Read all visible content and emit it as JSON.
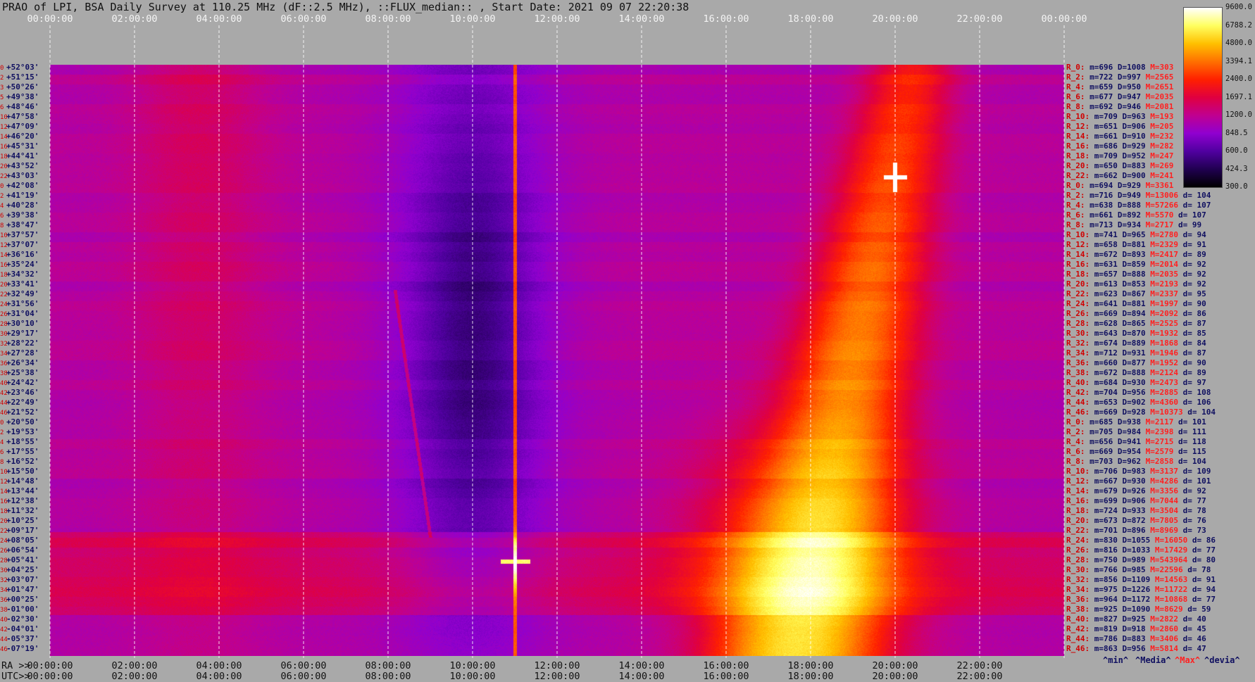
{
  "title": "PRAO of LPI, BSA Daily Survey at 110.25 MHz (dF::2.5 MHz), ::FLUX_median:: , Start Date: 2021 09 07 22:20:38",
  "top_axis": [
    "00:00:00",
    "02:00:00",
    "04:00:00",
    "06:00:00",
    "08:00:00",
    "10:00:00",
    "12:00:00",
    "14:00:00",
    "16:00:00",
    "18:00:00",
    "20:00:00",
    "22:00:00",
    "00:00:00"
  ],
  "ra_axis": {
    "label": "RA >>",
    "ticks": [
      "00:00:00",
      "02:00:00",
      "04:00:00",
      "06:00:00",
      "08:00:00",
      "10:00:00",
      "12:00:00",
      "14:00:00",
      "16:00:00",
      "18:00:00",
      "20:00:00",
      "22:00:00"
    ]
  },
  "utc_axis": {
    "label": "UTC>>",
    "ticks": [
      "00:00:00",
      "02:00:00",
      "04:00:00",
      "06:00:00",
      "08:00:00",
      "10:00:00",
      "12:00:00",
      "14:00:00",
      "16:00:00",
      "18:00:00",
      "20:00:00",
      "22:00:00"
    ]
  },
  "colorbar": {
    "labels": [
      "9600.0",
      "6788.2",
      "4800.0",
      "3394.1",
      "2400.0",
      "1697.1",
      "1200.0",
      "848.5",
      "600.0",
      "424.3",
      "300.0"
    ],
    "stops": [
      "#ffffff",
      "#ffff60",
      "#ffc000",
      "#ff7000",
      "#ff2000",
      "#e00040",
      "#c00090",
      "#9000d0",
      "#5000a0",
      "#200050",
      "#000000"
    ]
  },
  "declinations": [
    {
      "idx": "0",
      "dec": "+52°03'"
    },
    {
      "idx": "2",
      "dec": "+51°15'"
    },
    {
      "idx": "3",
      "dec": "+50°26'"
    },
    {
      "idx": "5",
      "dec": "+49°38'"
    },
    {
      "idx": "6",
      "dec": "+48°46'"
    },
    {
      "idx": "10",
      "dec": "+47°58'"
    },
    {
      "idx": "12",
      "dec": "+47°09'"
    },
    {
      "idx": "14",
      "dec": "+46°20'"
    },
    {
      "idx": "16",
      "dec": "+45°31'"
    },
    {
      "idx": "18",
      "dec": "+44°41'"
    },
    {
      "idx": "20",
      "dec": "+43°52'"
    },
    {
      "idx": "22",
      "dec": "+43°03'"
    },
    {
      "idx": "0",
      "dec": "+42°08'"
    },
    {
      "idx": "2",
      "dec": "+41°19'"
    },
    {
      "idx": "4",
      "dec": "+40°28'"
    },
    {
      "idx": "6",
      "dec": "+39°38'"
    },
    {
      "idx": "8",
      "dec": "+38°47'"
    },
    {
      "idx": "10",
      "dec": "+37°57'"
    },
    {
      "idx": "12",
      "dec": "+37°07'"
    },
    {
      "idx": "14",
      "dec": "+36°16'"
    },
    {
      "idx": "16",
      "dec": "+35°24'"
    },
    {
      "idx": "18",
      "dec": "+34°32'"
    },
    {
      "idx": "20",
      "dec": "+33°41'"
    },
    {
      "idx": "22",
      "dec": "+32°49'"
    },
    {
      "idx": "24",
      "dec": "+31°56'"
    },
    {
      "idx": "26",
      "dec": "+31°04'"
    },
    {
      "idx": "28",
      "dec": "+30°10'"
    },
    {
      "idx": "30",
      "dec": "+29°17'"
    },
    {
      "idx": "32",
      "dec": "+28°22'"
    },
    {
      "idx": "34",
      "dec": "+27°28'"
    },
    {
      "idx": "36",
      "dec": "+26°34'"
    },
    {
      "idx": "38",
      "dec": "+25°38'"
    },
    {
      "idx": "40",
      "dec": "+24°42'"
    },
    {
      "idx": "42",
      "dec": "+23°46'"
    },
    {
      "idx": "44",
      "dec": "+22°49'"
    },
    {
      "idx": "46",
      "dec": "+21°52'"
    },
    {
      "idx": "0",
      "dec": "+20°50'"
    },
    {
      "idx": "2",
      "dec": "+19°53'"
    },
    {
      "idx": "4",
      "dec": "+18°55'"
    },
    {
      "idx": "6",
      "dec": "+17°55'"
    },
    {
      "idx": "8",
      "dec": "+16°52'"
    },
    {
      "idx": "10",
      "dec": "+15°50'"
    },
    {
      "idx": "12",
      "dec": "+14°48'"
    },
    {
      "idx": "14",
      "dec": "+13°44'"
    },
    {
      "idx": "16",
      "dec": "+12°38'"
    },
    {
      "idx": "18",
      "dec": "+11°32'"
    },
    {
      "idx": "20",
      "dec": "+10°25'"
    },
    {
      "idx": "22",
      "dec": "+09°17'"
    },
    {
      "idx": "24",
      "dec": "+08°05'"
    },
    {
      "idx": "26",
      "dec": "+06°54'"
    },
    {
      "idx": "28",
      "dec": "+05°41'"
    },
    {
      "idx": "30",
      "dec": "+04°25'"
    },
    {
      "idx": "32",
      "dec": "+03°07'"
    },
    {
      "idx": "34",
      "dec": "+01°47'"
    },
    {
      "idx": "36",
      "dec": "+00°25'"
    },
    {
      "idx": "38",
      "dec": "-01°00'"
    },
    {
      "idx": "40",
      "dec": "-02°30'"
    },
    {
      "idx": "42",
      "dec": "-04°01'"
    },
    {
      "idx": "44",
      "dec": "-05°37'"
    },
    {
      "idx": "46",
      "dec": "-07°19'"
    }
  ],
  "stats": [
    {
      "r": "R_0:",
      "min": "m=696",
      "med": "D=1008",
      "max": "M=303",
      "dev": ""
    },
    {
      "r": "R_2:",
      "min": "m=722",
      "med": "D=997",
      "max": "M=2565",
      "dev": ""
    },
    {
      "r": "R_4:",
      "min": "m=659",
      "med": "D=950",
      "max": "M=2651",
      "dev": ""
    },
    {
      "r": "R_6:",
      "min": "m=677",
      "med": "D=947",
      "max": "M=2035",
      "dev": ""
    },
    {
      "r": "R_8:",
      "min": "m=692",
      "med": "D=946",
      "max": "M=2081",
      "dev": ""
    },
    {
      "r": "R_10:",
      "min": "m=709",
      "med": "D=963",
      "max": "M=193",
      "dev": ""
    },
    {
      "r": "R_12:",
      "min": "m=651",
      "med": "D=906",
      "max": "M=205",
      "dev": ""
    },
    {
      "r": "R_14:",
      "min": "m=661",
      "med": "D=910",
      "max": "M=232",
      "dev": ""
    },
    {
      "r": "R_16:",
      "min": "m=686",
      "med": "D=929",
      "max": "M=282",
      "dev": ""
    },
    {
      "r": "R_18:",
      "min": "m=709",
      "med": "D=952",
      "max": "M=247",
      "dev": ""
    },
    {
      "r": "R_20:",
      "min": "m=650",
      "med": "D=883",
      "max": "M=269",
      "dev": ""
    },
    {
      "r": "R_22:",
      "min": "m=662",
      "med": "D=900",
      "max": "M=241",
      "dev": ""
    },
    {
      "r": "R_0:",
      "min": "m=694",
      "med": "D=929",
      "max": "M=3361",
      "dev": ""
    },
    {
      "r": "R_2:",
      "min": "m=716",
      "med": "D=949",
      "max": "M=13006",
      "dev": "d= 104"
    },
    {
      "r": "R_4:",
      "min": "m=638",
      "med": "D=888",
      "max": "M=57266",
      "dev": "d= 107"
    },
    {
      "r": "R_6:",
      "min": "m=661",
      "med": "D=892",
      "max": "M=5570",
      "dev": "d= 107"
    },
    {
      "r": "R_8:",
      "min": "m=713",
      "med": "D=934",
      "max": "M=2717",
      "dev": "d= 99"
    },
    {
      "r": "R_10:",
      "min": "m=741",
      "med": "D=965",
      "max": "M=2780",
      "dev": "d= 94"
    },
    {
      "r": "R_12:",
      "min": "m=658",
      "med": "D=881",
      "max": "M=2329",
      "dev": "d= 91"
    },
    {
      "r": "R_14:",
      "min": "m=672",
      "med": "D=893",
      "max": "M=2417",
      "dev": "d= 89"
    },
    {
      "r": "R_16:",
      "min": "m=631",
      "med": "D=859",
      "max": "M=2014",
      "dev": "d= 92"
    },
    {
      "r": "R_18:",
      "min": "m=657",
      "med": "D=888",
      "max": "M=2035",
      "dev": "d= 92"
    },
    {
      "r": "R_20:",
      "min": "m=613",
      "med": "D=853",
      "max": "M=2193",
      "dev": "d= 92"
    },
    {
      "r": "R_22:",
      "min": "m=623",
      "med": "D=867",
      "max": "M=2337",
      "dev": "d= 95"
    },
    {
      "r": "R_24:",
      "min": "m=641",
      "med": "D=881",
      "max": "M=1997",
      "dev": "d= 90"
    },
    {
      "r": "R_26:",
      "min": "m=669",
      "med": "D=894",
      "max": "M=2092",
      "dev": "d= 86"
    },
    {
      "r": "R_28:",
      "min": "m=628",
      "med": "D=865",
      "max": "M=2525",
      "dev": "d= 87"
    },
    {
      "r": "R_30:",
      "min": "m=643",
      "med": "D=870",
      "max": "M=1932",
      "dev": "d= 85"
    },
    {
      "r": "R_32:",
      "min": "m=674",
      "med": "D=889",
      "max": "M=1868",
      "dev": "d= 84"
    },
    {
      "r": "R_34:",
      "min": "m=712",
      "med": "D=931",
      "max": "M=1946",
      "dev": "d= 87"
    },
    {
      "r": "R_36:",
      "min": "m=660",
      "med": "D=877",
      "max": "M=1952",
      "dev": "d= 90"
    },
    {
      "r": "R_38:",
      "min": "m=672",
      "med": "D=888",
      "max": "M=2124",
      "dev": "d= 89"
    },
    {
      "r": "R_40:",
      "min": "m=684",
      "med": "D=930",
      "max": "M=2473",
      "dev": "d= 97"
    },
    {
      "r": "R_42:",
      "min": "m=704",
      "med": "D=956",
      "max": "M=2885",
      "dev": "d= 108"
    },
    {
      "r": "R_44:",
      "min": "m=653",
      "med": "D=902",
      "max": "M=4360",
      "dev": "d= 106"
    },
    {
      "r": "R_46:",
      "min": "m=669",
      "med": "D=928",
      "max": "M=10373",
      "dev": "d= 104"
    },
    {
      "r": "R_0:",
      "min": "m=685",
      "med": "D=938",
      "max": "M=2117",
      "dev": "d= 101"
    },
    {
      "r": "R_2:",
      "min": "m=705",
      "med": "D=984",
      "max": "M=2398",
      "dev": "d= 111"
    },
    {
      "r": "R_4:",
      "min": "m=656",
      "med": "D=941",
      "max": "M=2715",
      "dev": "d= 118"
    },
    {
      "r": "R_6:",
      "min": "m=669",
      "med": "D=954",
      "max": "M=2579",
      "dev": "d= 115"
    },
    {
      "r": "R_8:",
      "min": "m=703",
      "med": "D=962",
      "max": "M=2858",
      "dev": "d= 104"
    },
    {
      "r": "R_10:",
      "min": "m=706",
      "med": "D=983",
      "max": "M=3137",
      "dev": "d= 109"
    },
    {
      "r": "R_12:",
      "min": "m=667",
      "med": "D=930",
      "max": "M=4286",
      "dev": "d= 101"
    },
    {
      "r": "R_14:",
      "min": "m=679",
      "med": "D=926",
      "max": "M=3356",
      "dev": "d= 92"
    },
    {
      "r": "R_16:",
      "min": "m=699",
      "med": "D=906",
      "max": "M=7044",
      "dev": "d= 77"
    },
    {
      "r": "R_18:",
      "min": "m=724",
      "med": "D=933",
      "max": "M=3504",
      "dev": "d= 78"
    },
    {
      "r": "R_20:",
      "min": "m=673",
      "med": "D=872",
      "max": "M=7805",
      "dev": "d= 76"
    },
    {
      "r": "R_22:",
      "min": "m=701",
      "med": "D=896",
      "max": "M=8969",
      "dev": "d= 73"
    },
    {
      "r": "R_24:",
      "min": "m=830",
      "med": "D=1055",
      "max": "M=16050",
      "dev": "d= 86"
    },
    {
      "r": "R_26:",
      "min": "m=816",
      "med": "D=1033",
      "max": "M=17429",
      "dev": "d= 77"
    },
    {
      "r": "R_28:",
      "min": "m=750",
      "med": "D=989",
      "max": "M=543964",
      "dev": "d= 80"
    },
    {
      "r": "R_30:",
      "min": "m=766",
      "med": "D=985",
      "max": "M=22596",
      "dev": "d= 78"
    },
    {
      "r": "R_32:",
      "min": "m=856",
      "med": "D=1109",
      "max": "M=14563",
      "dev": "d= 91"
    },
    {
      "r": "R_34:",
      "min": "m=975",
      "med": "D=1226",
      "max": "M=11722",
      "dev": "d= 94"
    },
    {
      "r": "R_36:",
      "min": "m=964",
      "med": "D=1172",
      "max": "M=10868",
      "dev": "d= 77"
    },
    {
      "r": "R_38:",
      "min": "m=925",
      "med": "D=1090",
      "max": "M=8629",
      "dev": "d= 59"
    },
    {
      "r": "R_40:",
      "min": "m=827",
      "med": "D=925",
      "max": "M=2822",
      "dev": "d= 40"
    },
    {
      "r": "R_42:",
      "min": "m=819",
      "med": "D=918",
      "max": "M=2860",
      "dev": "d= 45"
    },
    {
      "r": "R_44:",
      "min": "m=786",
      "med": "D=883",
      "max": "M=3406",
      "dev": "d= 46"
    },
    {
      "r": "R_46:",
      "min": "m=863",
      "med": "D=956",
      "max": "M=5814",
      "dev": "d= 47"
    }
  ],
  "footer_labels": {
    "min": "^min^",
    "median": "^Media^",
    "max": "^Max^",
    "devia": "^devia^"
  },
  "chart_data": {
    "type": "heatmap",
    "title": "PRAO of LPI, BSA Daily Survey at 110.25 MHz (dF::2.5 MHz), ::FLUX_median:: , Start Date: 2021 09 07 22:20:38",
    "x_unit": "hours",
    "xlim": [
      0,
      24
    ],
    "x_ticks": [
      "00:00:00",
      "02:00:00",
      "04:00:00",
      "06:00:00",
      "08:00:00",
      "10:00:00",
      "12:00:00",
      "14:00:00",
      "16:00:00",
      "18:00:00",
      "20:00:00",
      "22:00:00",
      "00:00:00"
    ],
    "rows": 60,
    "grid": true,
    "colorscale_range": [
      300,
      9600
    ],
    "features": [
      {
        "kind": "vertical_source_line",
        "ra_hours": 11.0,
        "peak_row": 50,
        "peak_value": 9600
      },
      {
        "kind": "point_source",
        "ra_hours": 20.0,
        "row": 14,
        "value": 9600
      },
      {
        "kind": "galactic_band",
        "ra_from_hours": 17.5,
        "ra_to_hours": 20.4,
        "value": 3000
      },
      {
        "kind": "cold_region",
        "ra_from_hours": 8.0,
        "ra_to_hours": 12.0,
        "value": 600
      }
    ]
  }
}
